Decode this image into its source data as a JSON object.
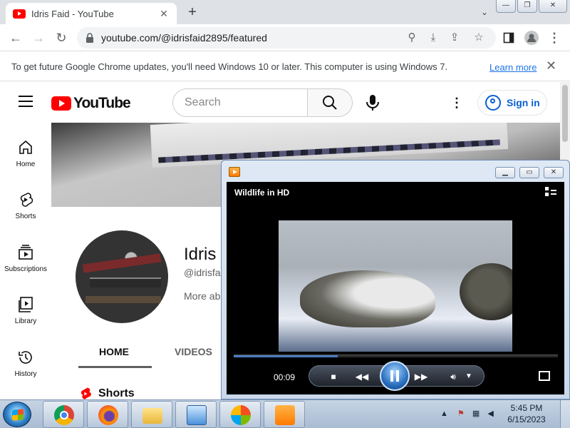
{
  "browser": {
    "tab_title": "Idris Faid - YouTube",
    "url": "youtube.com/@idrisfaid2895/featured",
    "infobar_message": "To get future Google Chrome updates, you'll need Windows 10 or later. This computer is using Windows 7.",
    "infobar_link": "Learn more"
  },
  "youtube": {
    "logo_text": "YouTube",
    "search_placeholder": "Search",
    "sign_in": "Sign in",
    "nav": [
      {
        "label": "Home",
        "icon": "home-icon"
      },
      {
        "label": "Shorts",
        "icon": "shorts-icon"
      },
      {
        "label": "Subscriptions",
        "icon": "subscriptions-icon"
      },
      {
        "label": "Library",
        "icon": "library-icon"
      },
      {
        "label": "History",
        "icon": "history-icon"
      }
    ],
    "channel": {
      "name": "Idris",
      "handle": "@idrisfa",
      "more_about": "More ab"
    },
    "tabs": [
      "HOME",
      "VIDEOS"
    ],
    "section_title": "Shorts"
  },
  "media_player": {
    "video_title": "Wildlife in HD",
    "elapsed": "00:09",
    "progress": 0.32
  },
  "taskbar": {
    "time": "5:45 PM",
    "date": "6/15/2023"
  },
  "colors": {
    "youtube_red": "#ff0000",
    "link_blue": "#1a73e8",
    "signin_blue": "#065fd4"
  }
}
